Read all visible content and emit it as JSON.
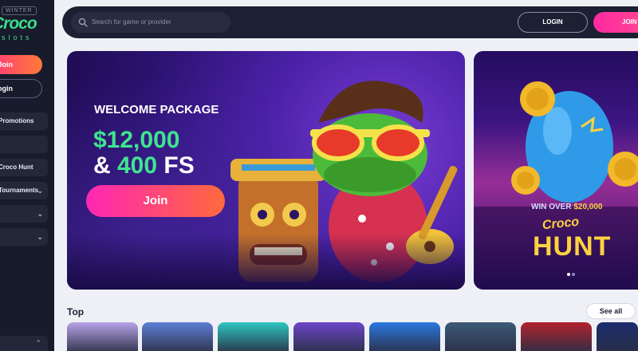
{
  "logo": {
    "tag": "WINTER",
    "main": "Croco",
    "sub": "slots"
  },
  "sidebar": {
    "join_label": "Join",
    "login_label": "Login",
    "items": [
      {
        "label": "Promotions",
        "has_chevron": false
      },
      {
        "label": "",
        "has_chevron": false
      },
      {
        "label": "Croco Hunt",
        "has_chevron": false
      },
      {
        "label": "Tournaments",
        "has_chevron": true
      },
      {
        "label": "",
        "has_chevron": true
      },
      {
        "label": "",
        "has_chevron": true
      }
    ]
  },
  "header": {
    "search_placeholder": "Search for game or provider",
    "login_label": "LOGIN",
    "join_label": "JOIN"
  },
  "hero": {
    "kicker": "WELCOME PACKAGE",
    "amount": "$12,000",
    "amp": "& ",
    "fs_number": "400",
    "fs_label": " FS",
    "button_label": "Join"
  },
  "promo2": {
    "win_prefix": "WIN OVER ",
    "win_amount": "$20,000",
    "logo_top": "Croco",
    "logo_bottom": "HUNT"
  },
  "top_section": {
    "title": "Top",
    "see_all_label": "See all",
    "games": [
      {
        "name": "game-tile-1",
        "color": "#b7a3e8"
      },
      {
        "name": "game-tile-2",
        "color": "#5f7fd6"
      },
      {
        "name": "game-tile-3",
        "color": "#2ec6c1"
      },
      {
        "name": "game-tile-4",
        "color": "#6c46c9"
      },
      {
        "name": "game-tile-5",
        "color": "#2a78e0"
      },
      {
        "name": "game-tile-6",
        "color": "#3d5a78"
      },
      {
        "name": "game-tile-7",
        "color": "#b2222c"
      },
      {
        "name": "game-tile-8",
        "color": "#1b2b6e"
      }
    ]
  },
  "colors": {
    "accent_pink": "#ff2a86",
    "accent_green": "#3ee58f",
    "accent_yellow": "#ffd23f",
    "dark_bg": "#171b2c"
  }
}
